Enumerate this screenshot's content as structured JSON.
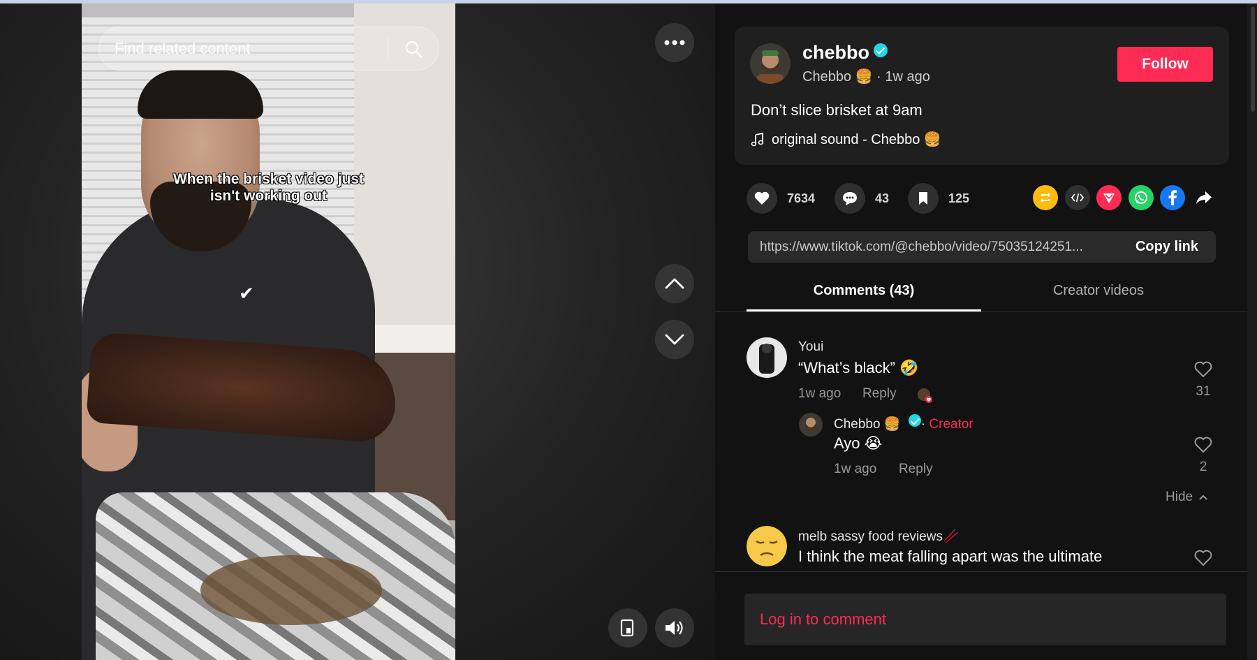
{
  "search": {
    "placeholder": "Find related content"
  },
  "video": {
    "caption_line1": "When the brisket video just",
    "caption_line2": "isn't working out"
  },
  "author": {
    "username": "chebbo",
    "nickname": "Chebbo 🍔",
    "posted": "1w ago",
    "follow_label": "Follow",
    "description": "Don’t slice brisket at 9am",
    "sound": "original sound - Chebbo 🍔"
  },
  "stats": {
    "likes": "7634",
    "comments": "43",
    "saves": "125"
  },
  "share": {
    "link": "https://www.tiktok.com/@chebbo/video/75035124251...",
    "copy_label": "Copy link",
    "icons": [
      "repost-icon",
      "embed-icon",
      "send-icon",
      "whatsapp-icon",
      "facebook-icon",
      "share-arrow-icon"
    ]
  },
  "tabs": {
    "comments": "Comments (43)",
    "creator_videos": "Creator videos"
  },
  "comments": [
    {
      "name": "Youi",
      "text": "“What’s black” 🤣",
      "time": "1w ago",
      "reply_label": "Reply",
      "likes": "31",
      "replies": [
        {
          "name": "Chebbo 🍔",
          "badge": "Creator",
          "text": "Ayo 😭",
          "time": "1w ago",
          "reply_label": "Reply",
          "likes": "2"
        }
      ],
      "hide_label": "Hide"
    },
    {
      "name": "melb sassy food reviews🥢",
      "text": "I think the meat falling apart was the ultimate"
    }
  ],
  "login": {
    "label": "Log in to comment"
  },
  "colors": {
    "accent": "#fe2c55",
    "verified": "#20d5ec",
    "background": "#121212"
  }
}
